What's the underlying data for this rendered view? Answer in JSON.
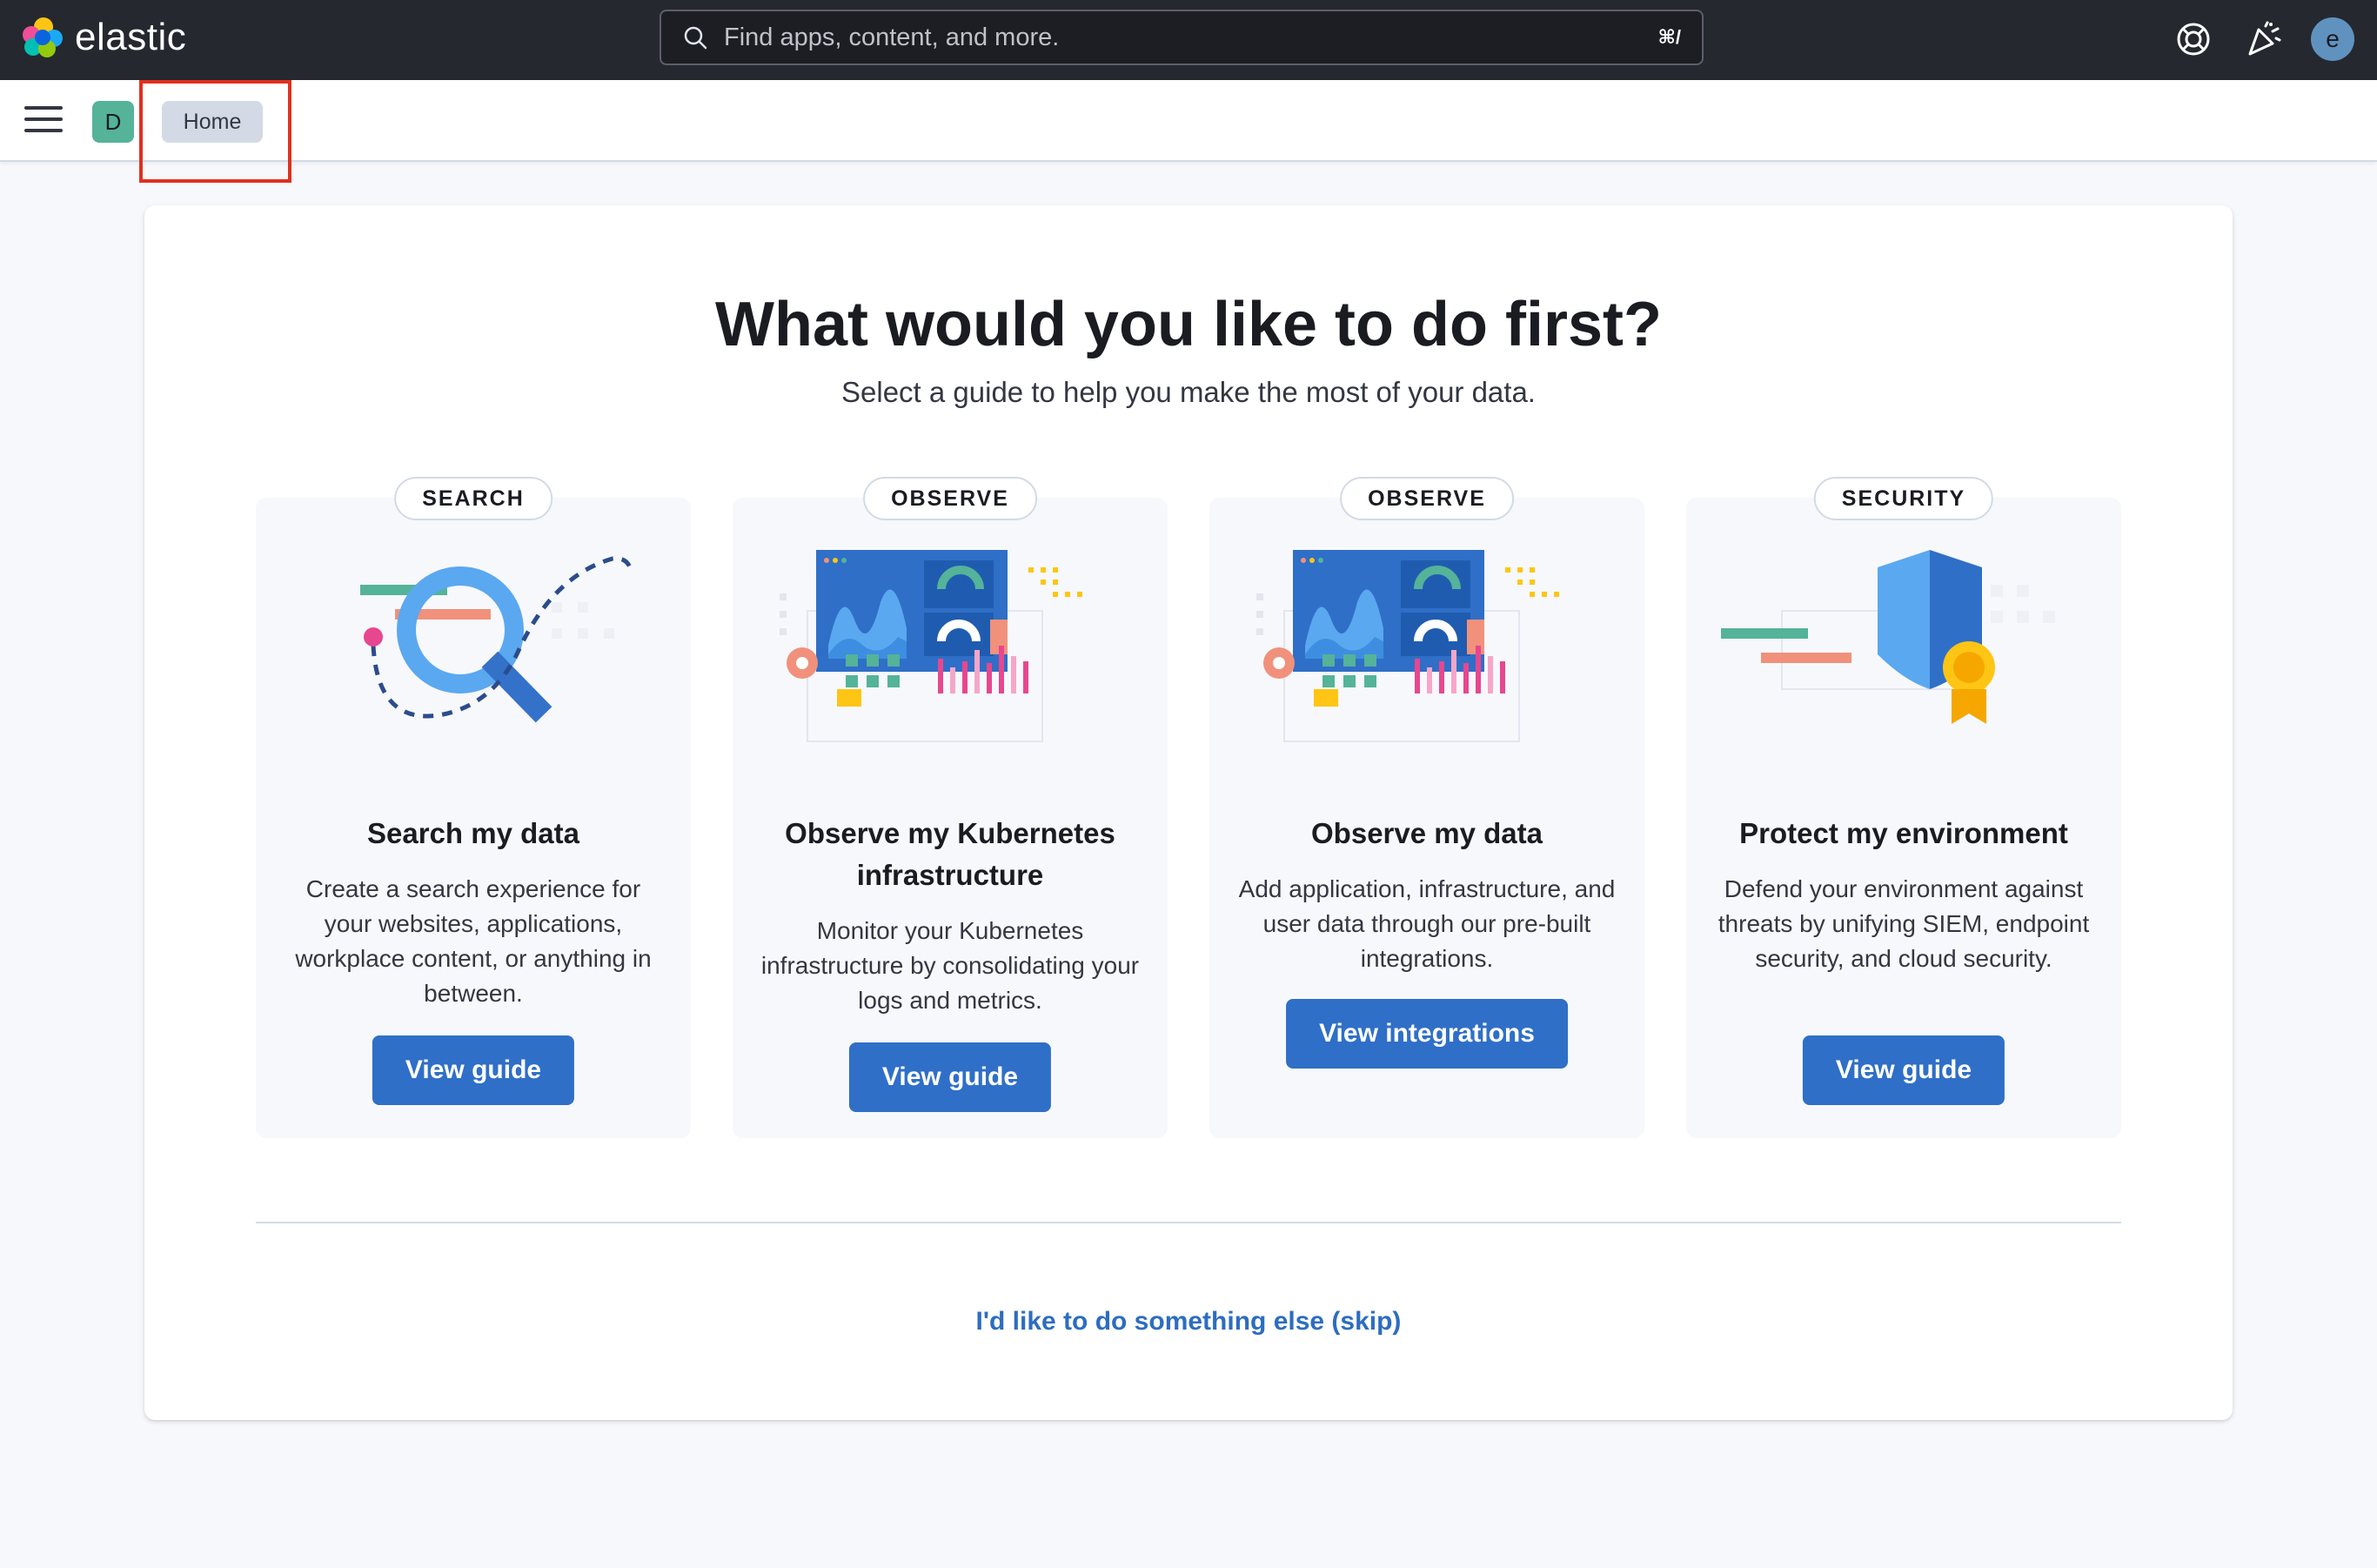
{
  "header": {
    "brand": "elastic",
    "search_placeholder": "Find apps, content, and more.",
    "search_shortcut": "⌘/",
    "user_initial": "e"
  },
  "subheader": {
    "space_initial": "D",
    "breadcrumb": "Home"
  },
  "main": {
    "title": "What would you like to do first?",
    "subtitle": "Select a guide to help you make the most of your data.",
    "skip_link": "I'd like to do something else (skip)",
    "cards": [
      {
        "badge": "SEARCH",
        "title": "Search my data",
        "description": "Create a search experience for your websites, applications, workplace content, or anything in between.",
        "button": "View guide"
      },
      {
        "badge": "OBSERVE",
        "title": "Observe my Kubernetes infrastructure",
        "description": "Monitor your Kubernetes infrastructure by consolidating your logs and metrics.",
        "button": "View guide"
      },
      {
        "badge": "OBSERVE",
        "title": "Observe my data",
        "description": "Add application, infrastructure, and user data through our pre-built integrations.",
        "button": "View integrations"
      },
      {
        "badge": "SECURITY",
        "title": "Protect my environment",
        "description": "Defend your environment against threats by unifying SIEM, endpoint security, and cloud security.",
        "button": "View guide"
      }
    ]
  },
  "colors": {
    "header_bg": "#25282f",
    "primary_button": "#2f6fc7",
    "link": "#2d6dc1",
    "card_bg": "#f7f8fc",
    "highlight": "#e0301e"
  }
}
